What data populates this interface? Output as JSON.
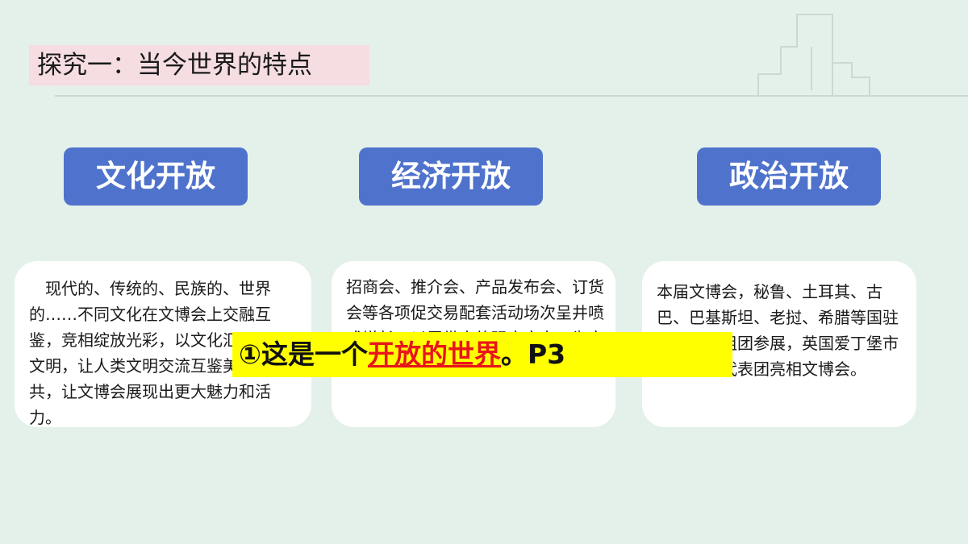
{
  "header": {
    "title": "探究一：当今世界的特点"
  },
  "categories": [
    {
      "label": "文化开放",
      "text": "现代的、传统的、民族的、世界的……不同文化在文博会上交融互鉴，竞相绽放光彩，以文化汇通世界文明，让人类文明交流互鉴美美与共，让文博会展现出更大魅力和活力。"
    },
    {
      "label": "经济开放",
      "text": "招商会、推介会、产品发布会、订货会等各项促交易配套活动场次呈井喷式增长，以展带商的强大实力，为交易注入新动力。"
    },
    {
      "label": "政治开放",
      "text": "本届文博会，秘鲁、土耳其、古巴、巴基斯坦、老挝、希腊等国驻华使领馆组团参展，英国爱丁堡市市长亲率代表团亮相文博会。"
    }
  ],
  "callout": {
    "prefix": "①这是一个",
    "highlight": "开放的世界",
    "suffix": "。P3"
  },
  "colors": {
    "background": "#e3f1ea",
    "button": "#4f73cc",
    "callout": "#ffff00",
    "highlight": "#e8151b",
    "title_bg": "#f5dde2"
  }
}
